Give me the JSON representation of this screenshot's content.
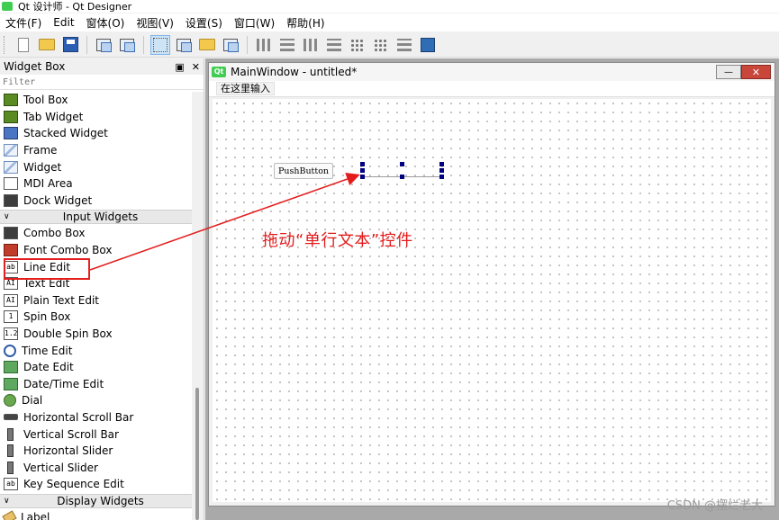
{
  "window": {
    "title": "Qt 设计师 - Qt Designer"
  },
  "menubar": [
    "文件(F)",
    "Edit",
    "窗体(O)",
    "视图(V)",
    "设置(S)",
    "窗口(W)",
    "帮助(H)"
  ],
  "toolbar": {
    "icons": [
      "new-file-icon",
      "open-file-icon",
      "save-icon",
      "send-to-back-icon",
      "bring-to-front-icon",
      "edit-widgets-icon",
      "edit-signals-slots-icon",
      "edit-buddies-icon",
      "edit-tab-order-icon",
      "layout-horizontal-icon",
      "layout-vertical-icon",
      "layout-horizontal-splitter-icon",
      "layout-vertical-splitter-icon",
      "layout-grid-icon",
      "layout-form-icon",
      "break-layout-icon",
      "adjust-size-icon"
    ]
  },
  "widgetbox": {
    "title": "Widget Box",
    "filter_placeholder": "Filter",
    "items_top": [
      "Tool Box",
      "Tab Widget",
      "Stacked Widget",
      "Frame",
      "Widget",
      "MDI Area",
      "Dock Widget"
    ],
    "category_input": "Input Widgets",
    "items_input": [
      "Combo Box",
      "Font Combo Box",
      "Line Edit",
      "Text Edit",
      "Plain Text Edit",
      "Spin Box",
      "Double Spin Box",
      "Time Edit",
      "Date Edit",
      "Date/Time Edit",
      "Dial",
      "Horizontal Scroll Bar",
      "Vertical Scroll Bar",
      "Horizontal Slider",
      "Vertical Slider",
      "Key Sequence Edit"
    ],
    "category_display": "Display Widgets",
    "items_display": [
      "Label"
    ]
  },
  "form": {
    "title": "MainWindow - untitled*",
    "menu_placeholder": "在这里输入",
    "pushbutton_label": "PushButton"
  },
  "annotation": {
    "text": "拖动“单行文本”控件",
    "color": "#e41b1b"
  },
  "watermark": "CSDN @摆烂老大"
}
